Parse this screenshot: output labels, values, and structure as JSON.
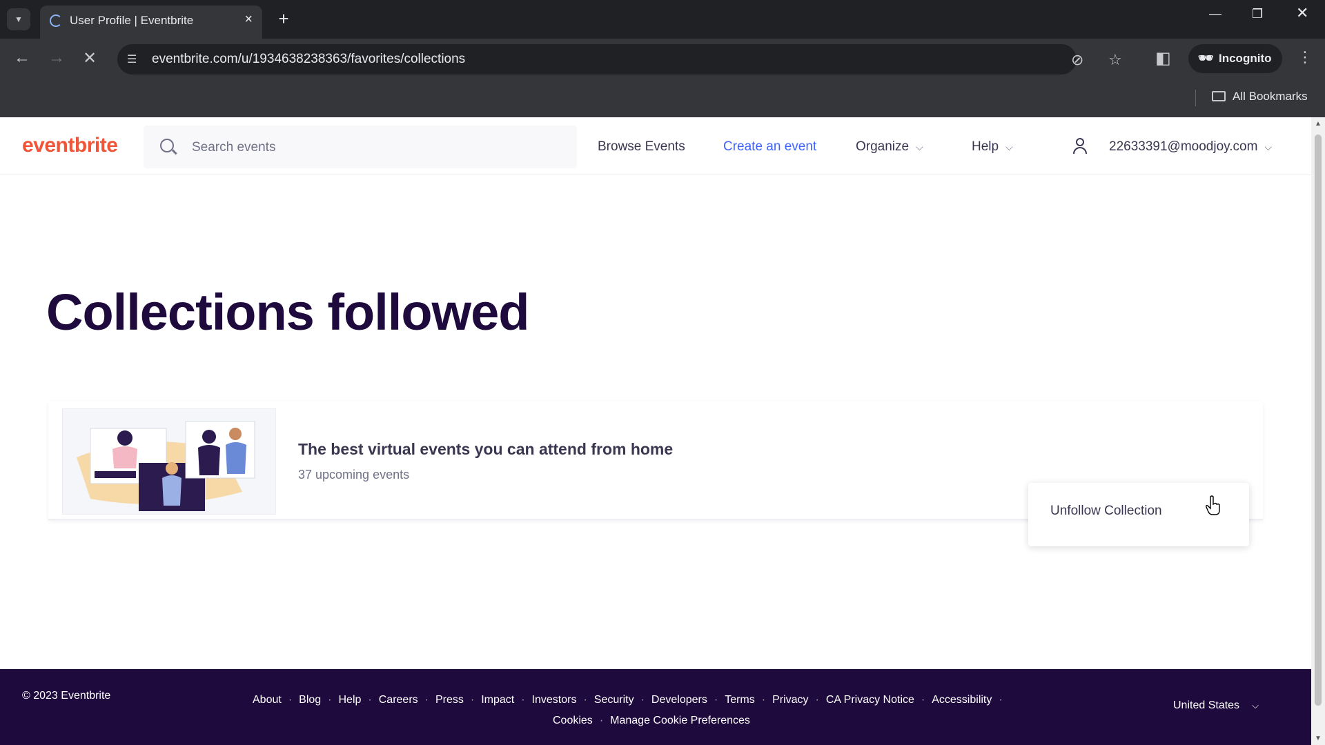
{
  "browser": {
    "tab_title": "User Profile | Eventbrite",
    "url": "eventbrite.com/u/1934638238363/favorites/collections",
    "incognito_label": "Incognito",
    "bookmarks_label": "All Bookmarks"
  },
  "header": {
    "logo": "eventbrite",
    "search_placeholder": "Search events",
    "nav": {
      "browse": "Browse Events",
      "create": "Create an event",
      "organize": "Organize",
      "help": "Help"
    },
    "user_email": "22633391@moodjoy.com"
  },
  "main": {
    "title": "Collections followed",
    "collection": {
      "title": "The best virtual events you can attend from home",
      "subtitle": "37 upcoming events"
    },
    "menu": {
      "unfollow": "Unfollow Collection"
    }
  },
  "footer": {
    "copyright": "© 2023 Eventbrite",
    "links": [
      "About",
      "Blog",
      "Help",
      "Careers",
      "Press",
      "Impact",
      "Investors",
      "Security",
      "Developers",
      "Terms",
      "Privacy",
      "CA Privacy Notice",
      "Accessibility"
    ],
    "links_row2": [
      "Cookies",
      "Manage Cookie Preferences"
    ],
    "country": "United States"
  },
  "colors": {
    "brand": "#f05537",
    "title": "#1e0a3c",
    "link_blue": "#3d64ff",
    "footer_bg": "#1e0a3c"
  }
}
